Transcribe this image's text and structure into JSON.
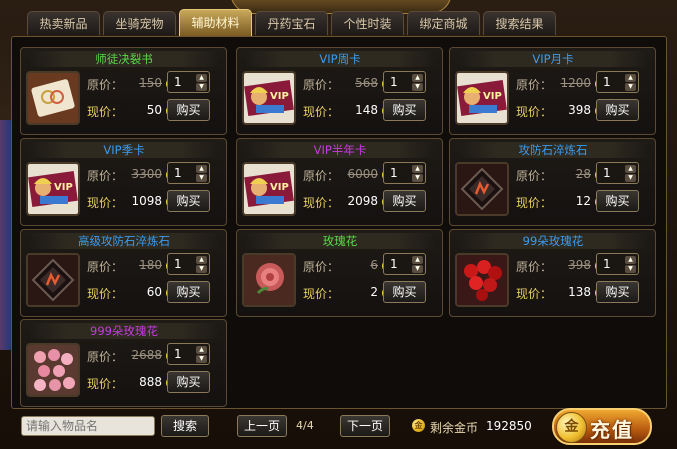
{
  "tabs": [
    {
      "label": "热卖新品"
    },
    {
      "label": "坐骑宠物"
    },
    {
      "label": "辅助材料"
    },
    {
      "label": "丹药宝石"
    },
    {
      "label": "个性时装"
    },
    {
      "label": "绑定商城"
    },
    {
      "label": "搜索结果"
    }
  ],
  "active_tab": "辅助材料",
  "labels": {
    "original_price": "原价：",
    "current_price": "现价：",
    "buy": "购买",
    "coin_glyph": "金"
  },
  "items": [
    {
      "name": "师徒决裂书",
      "name_color": "#5ad84a",
      "original": "150",
      "current": "50",
      "qty": "1",
      "icon": "letter-icon"
    },
    {
      "name": "VIP周卡",
      "name_color": "#3a9cf0",
      "original": "568",
      "current": "148",
      "qty": "1",
      "icon": "vip-card-icon"
    },
    {
      "name": "VIP月卡",
      "name_color": "#3a9cf0",
      "original": "1200",
      "current": "398",
      "qty": "1",
      "icon": "vip-card-icon"
    },
    {
      "name": "VIP季卡",
      "name_color": "#3a9cf0",
      "original": "3300",
      "current": "1098",
      "qty": "1",
      "icon": "vip-card-icon"
    },
    {
      "name": "VIP半年卡",
      "name_color": "#c83ae0",
      "original": "6000",
      "current": "2098",
      "qty": "1",
      "icon": "vip-card-icon"
    },
    {
      "name": "攻防石淬炼石",
      "name_color": "#3a9cf0",
      "original": "28",
      "current": "12",
      "qty": "1",
      "icon": "forge-stone-icon"
    },
    {
      "name": "高级攻防石淬炼石",
      "name_color": "#3a9cf0",
      "original": "180",
      "current": "60",
      "qty": "1",
      "icon": "forge-stone-icon"
    },
    {
      "name": "玫瑰花",
      "name_color": "#5ad84a",
      "original": "6",
      "current": "2",
      "qty": "1",
      "icon": "rose-icon"
    },
    {
      "name": "99朵玫瑰花",
      "name_color": "#3a9cf0",
      "original": "398",
      "current": "138",
      "qty": "1",
      "icon": "rose-bouquet-icon"
    },
    {
      "name": "999朵玫瑰花",
      "name_color": "#c83ae0",
      "original": "2688",
      "current": "888",
      "qty": "1",
      "icon": "pink-roses-icon"
    }
  ],
  "search": {
    "placeholder": "请输入物品名",
    "button": "搜索"
  },
  "pagination": {
    "prev": "上一页",
    "indicator": "4/4",
    "next": "下一页"
  },
  "gold": {
    "label": "剩余金币",
    "value": "192850"
  },
  "recharge": {
    "label": "充值",
    "coin_glyph": "金"
  }
}
